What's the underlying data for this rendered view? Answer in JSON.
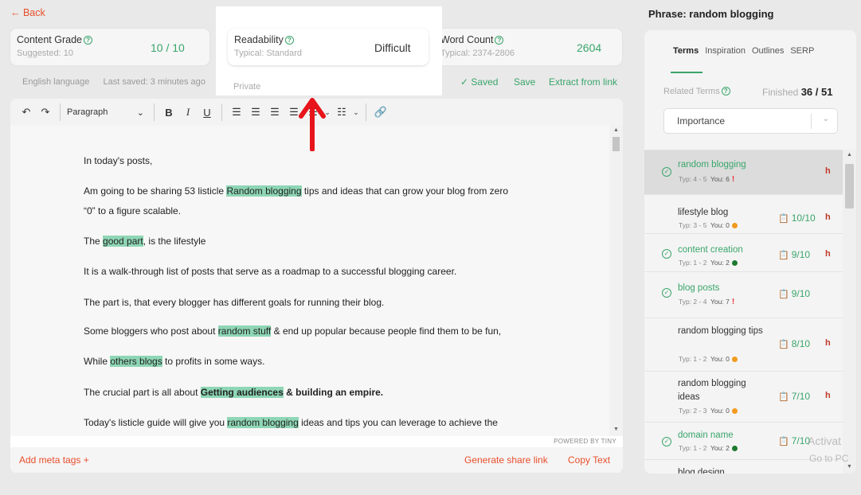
{
  "header": {
    "back_label": "← Back"
  },
  "cards": {
    "grade": {
      "label": "Content Grade",
      "sub": "Suggested: 10",
      "value": "10 / 10"
    },
    "readability": {
      "label": "Readability",
      "sub": "Typical: Standard",
      "value": "Difficult"
    },
    "word_count": {
      "label": "Word Count",
      "sub": "Typical: 2374-2806",
      "value": "2604"
    }
  },
  "meta": {
    "language": "English language",
    "last_saved": "Last saved: 3 minutes ago",
    "privacy": "Private"
  },
  "actions": {
    "saved": "✓ Saved",
    "save": "Save",
    "extract": "Extract from link"
  },
  "toolbar": {
    "paragraph": "Paragraph"
  },
  "document": {
    "p1": "In today's posts,",
    "p2a": "Am going to be sharing 53 listicle ",
    "p2h": "Random blogging",
    "p2b": " tips and ideas that can grow your blog from zero",
    "p3": "“0” to a figure scalable.",
    "p4a": "The ",
    "p4h": "good part",
    "p4b": ", is the lifestyle",
    "p5": "It is a walk-through list of posts that serve as a roadmap to a successful blogging career.",
    "p6": "The part is, that every blogger has different goals for running their blog.",
    "p7a": "Some bloggers who post about ",
    "p7h": "random stuff",
    "p7b": " & end up popular because people find them to be fun,",
    "p8a": "While ",
    "p8h": "others blogs",
    "p8b": " to profits in some ways.",
    "p9a": "The crucial part is all about ",
    "p9h": "Getting audiences",
    "p9b": " & building an empire.",
    "p10a": "Today's listicle guide will give you ",
    "p10h": "random blogging",
    "p10b": " ideas and tips you can leverage to achieve the"
  },
  "editor_footer": {
    "powered": "POWERED BY TINY",
    "meta_tags": "Add meta tags +",
    "share": "Generate share link",
    "copy": "Copy Text"
  },
  "side": {
    "phrase": "Phrase: random blogging",
    "tabs": [
      "Terms",
      "Inspiration",
      "Outlines",
      "SERP"
    ],
    "related_label": "Related Terms",
    "finished_label": "Finished",
    "finished_value": "36 / 51",
    "sort": "Importance",
    "terms": [
      {
        "name": "random blogging",
        "typ": "Typ: 4 - 5",
        "you": "You: 6",
        "score": "",
        "h": "h"
      },
      {
        "name": "lifestyle blog",
        "typ": "Typ: 3 - 5",
        "you": "You: 0",
        "score": "10/10",
        "h": "h"
      },
      {
        "name": "content creation",
        "typ": "Typ: 1 - 2",
        "you": "You: 2",
        "score": "9/10",
        "h": "h"
      },
      {
        "name": "blog posts",
        "typ": "Typ: 2 - 4",
        "you": "You: 7",
        "score": "9/10",
        "h": ""
      },
      {
        "name": "random blogging tips",
        "typ": "Typ: 1 - 2",
        "you": "You: 0",
        "score": "8/10",
        "h": "h"
      },
      {
        "name": "random blogging ideas",
        "typ": "Typ: 2 - 3",
        "you": "You: 0",
        "score": "7/10",
        "h": "h"
      },
      {
        "name": "domain name",
        "typ": "Typ: 1 - 2",
        "you": "You: 2",
        "score": "7/10",
        "h": ""
      },
      {
        "name": "blog design",
        "typ": "",
        "you": "",
        "score": "",
        "h": ""
      }
    ]
  },
  "watermark": {
    "line1": "Activat",
    "line2": "Go to PC"
  },
  "colors": {
    "accent_green": "#3aa56b",
    "accent_red": "#e84e2b",
    "highlight": "#8ed6b5",
    "dot_orange": "#f29a1f",
    "dot_green": "#1e7a2f"
  }
}
